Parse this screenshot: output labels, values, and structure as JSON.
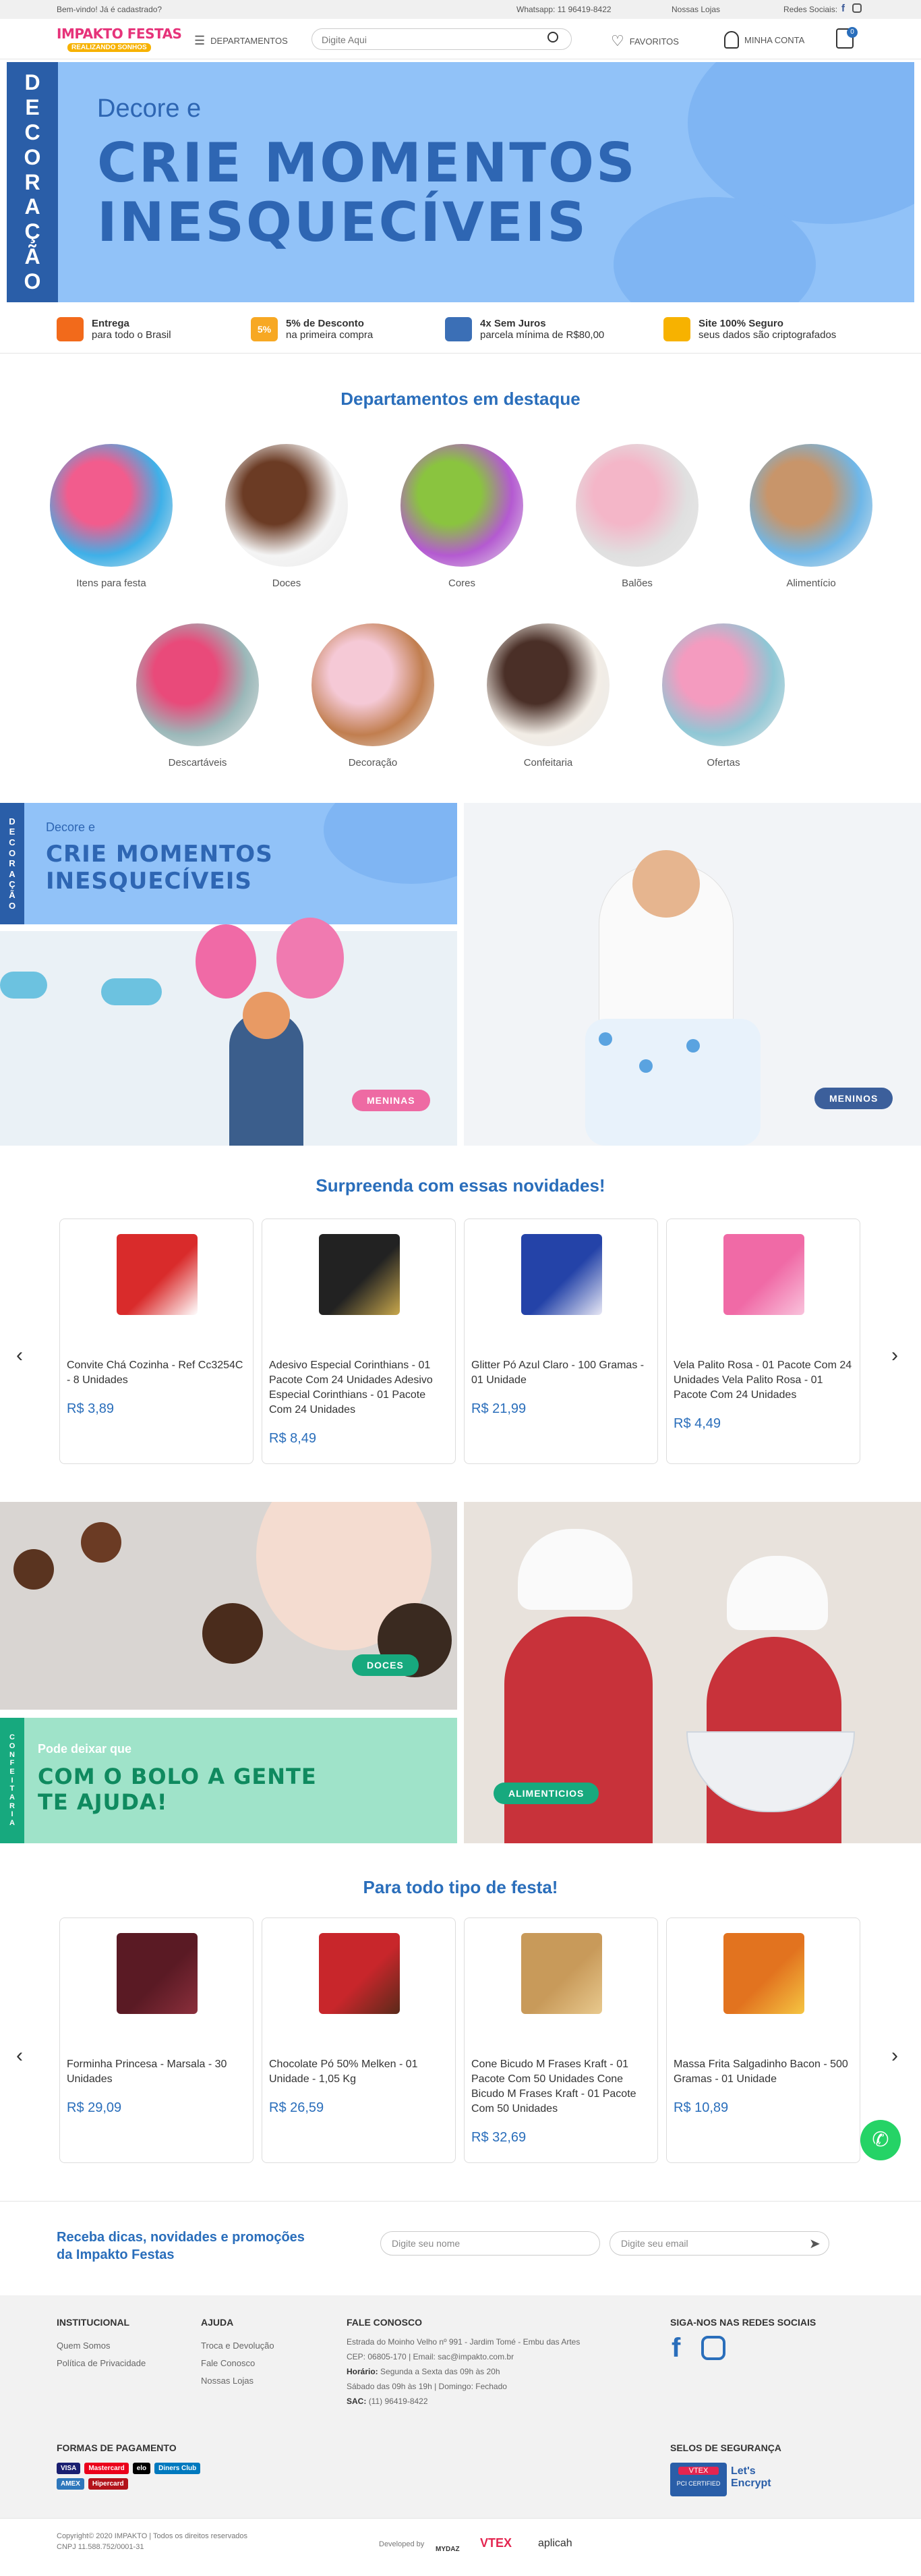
{
  "topbar": {
    "welcome": "Bem-vindo! Já é cadastrado?",
    "whatsapp": "Whatsapp: 11 96419-8422",
    "stores": "Nossas Lojas",
    "social": "Redes Sociais:"
  },
  "header": {
    "logo": "IMPAKTO FESTAS",
    "logo_sub": "REALIZANDO SONHOS",
    "departments": "DEPARTAMENTOS",
    "search_placeholder": "Digite Aqui",
    "favorites": "FAVORITOS",
    "account": "MINHA CONTA",
    "cart_count": "0"
  },
  "hero": {
    "vertical": [
      "D",
      "E",
      "C",
      "O",
      "R",
      "A",
      "Ç",
      "Ã",
      "O"
    ],
    "small": "Decore e",
    "big_line1": "CRIE MOMENTOS",
    "big_line2": "INESQUECÍVEIS"
  },
  "benefits": [
    {
      "title": "Entrega",
      "sub": "para todo o Brasil",
      "icon": "truck-icon",
      "color": "#f26a1b"
    },
    {
      "title": "5% de Desconto",
      "sub": "na primeira compra",
      "icon": "discount-icon",
      "color": "#f7a823",
      "glyph": "5%"
    },
    {
      "title": "4x Sem Juros",
      "sub": "parcela mínima de R$80,00",
      "icon": "card-icon",
      "color": "#3b6fb6"
    },
    {
      "title": "Site 100% Seguro",
      "sub": "seus dados são criptografados",
      "icon": "lock-icon",
      "color": "#f7b200"
    }
  ],
  "departments": {
    "title": "Departamentos em destaque",
    "items": [
      {
        "label": "Itens para festa",
        "c1": "#f25c8d",
        "c2": "#3fb0e8"
      },
      {
        "label": "Doces",
        "c1": "#6b3b24",
        "c2": "#f4f4f4"
      },
      {
        "label": "Cores",
        "c1": "#8ac43f",
        "c2": "#b45ad1"
      },
      {
        "label": "Balões",
        "c1": "#f4b6c8",
        "c2": "#e0e0e0"
      },
      {
        "label": "Alimentício",
        "c1": "#c8956a",
        "c2": "#6fb7e8"
      },
      {
        "label": "Descartáveis",
        "c1": "#e94a7a",
        "c2": "#9bb8b9"
      },
      {
        "label": "Decoração",
        "c1": "#f5c9d6",
        "c2": "#c17e4f"
      },
      {
        "label": "Confeitaria",
        "c1": "#4a2f27",
        "c2": "#f2ede6"
      },
      {
        "label": "Ofertas",
        "c1": "#f49bbf",
        "c2": "#8fc7d5"
      }
    ]
  },
  "banners1": {
    "vertical": [
      "D",
      "E",
      "C",
      "O",
      "R",
      "A",
      "Ç",
      "Ã",
      "O"
    ],
    "small": "Decore e",
    "big_line1": "CRIE MOMENTOS",
    "big_line2": "INESQUECÍVEIS",
    "girls": "MENINAS",
    "boys": "MENINOS"
  },
  "news": {
    "title": "Surpreenda com essas novidades!",
    "products": [
      {
        "name": "Convite Chá Cozinha - Ref Cc3254C - 8 Unidades",
        "price": "R$ 3,89",
        "c1": "#d92b2b",
        "c2": "#ffffff"
      },
      {
        "name": "Adesivo Especial Corinthians - 01 Pacote Com 24 Unidades Adesivo Especial Corinthians - 01 Pacote Com 24 Unidades",
        "price": "R$ 8,49",
        "c1": "#222222",
        "c2": "#c9a84c"
      },
      {
        "name": "Glitter Pó Azul Claro - 100 Gramas - 01 Unidade",
        "price": "R$ 21,99",
        "c1": "#2443a8",
        "c2": "#e8e8f5"
      },
      {
        "name": "Vela Palito Rosa - 01 Pacote Com 24 Unidades Vela Palito Rosa - 01 Pacote Com 24 Unidades",
        "price": "R$ 4,49",
        "c1": "#f06aa6",
        "c2": "#f9c3dc"
      }
    ]
  },
  "banners2": {
    "sweets": "DOCES",
    "confeitaria_vertical": [
      "C",
      "O",
      "N",
      "F",
      "E",
      "I",
      "T",
      "A",
      "R",
      "I",
      "A"
    ],
    "small": "Pode deixar que",
    "big_line1": "COM O BOLO A GENTE",
    "big_line2": "TE AJUDA!",
    "food": "ALIMENTICIOS"
  },
  "party": {
    "title": "Para todo tipo de festa!",
    "products": [
      {
        "name": "Forminha Princesa - Marsala - 30 Unidades",
        "price": "R$ 29,09",
        "c1": "#5a1a24",
        "c2": "#8b2f3c"
      },
      {
        "name": "Chocolate Pó 50% Melken - 01 Unidade - 1,05 Kg",
        "price": "R$ 26,59",
        "c1": "#c8262b",
        "c2": "#5a2a1a"
      },
      {
        "name": "Cone Bicudo M Frases Kraft - 01 Pacote Com 50 Unidades Cone Bicudo M Frases Kraft - 01 Pacote Com 50 Unidades",
        "price": "R$ 32,69",
        "c1": "#c89a5a",
        "c2": "#e8c98e"
      },
      {
        "name": "Massa Frita Salgadinho Bacon - 500 Gramas - 01 Unidade",
        "price": "R$ 10,89",
        "c1": "#e2731f",
        "c2": "#f5c542"
      }
    ]
  },
  "newsletter": {
    "title_line1": "Receba dicas, novidades e promoções",
    "title_line2": "da Impakto Festas",
    "name_placeholder": "Digite seu nome",
    "email_placeholder": "Digite seu email"
  },
  "footer": {
    "inst_title": "INSTITUCIONAL",
    "inst": [
      "Quem Somos",
      "Política de Privacidade"
    ],
    "help_title": "AJUDA",
    "help": [
      "Troca e Devolução",
      "Fale Conosco",
      "Nossas Lojas"
    ],
    "contact_title": "FALE CONOSCO",
    "contact": [
      "Estrada do Moinho Velho nº 991 - Jardim Tomé - Embu das Artes",
      "CEP: 06805-170 | Email: sac@impakto.com.br"
    ],
    "hours_label": "Horário:",
    "hours": "Segunda a Sexta das 09h às 20h",
    "hours2": "Sábado das 09h às 19h | Domingo: Fechado",
    "sac_label": "SAC:",
    "sac": "(11) 96419-8422",
    "social_title": "SIGA-NOS NAS REDES SOCIAIS",
    "payment_title": "FORMAS DE PAGAMENTO",
    "payments": [
      "VISA",
      "Mastercard",
      "elo",
      "Diners Club",
      "AMEX",
      "Hipercard"
    ],
    "security_title": "SELOS DE SEGURANÇA",
    "vtex_seal": "VTEX",
    "pci": "PCI CERTIFIED",
    "letsencrypt": "Let's Encrypt"
  },
  "bottom": {
    "copyright": "Copyright© 2020 IMPAKTO | Todos os direitos reservados",
    "cnpj": "CNPJ 11.588.752/0001-31",
    "developed": "Developed by",
    "mydaz": "MYDAZ",
    "vtex": "VTEX",
    "aplicah": "aplicah"
  },
  "whatsapp_float": "whatsapp-icon"
}
